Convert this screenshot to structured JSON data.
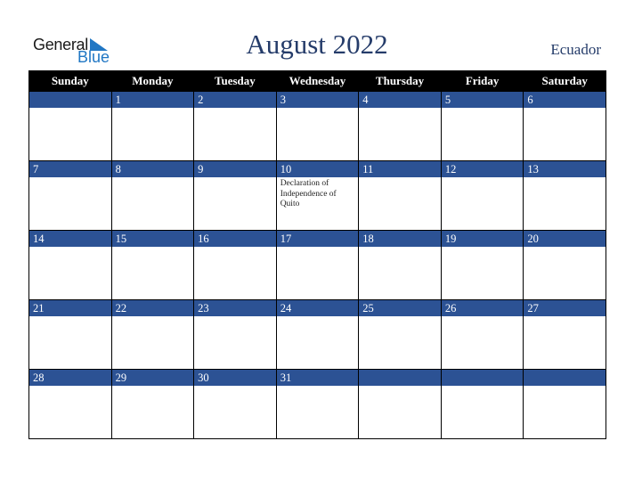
{
  "logo": {
    "word1": "General",
    "word2": "Blue"
  },
  "header": {
    "title": "August 2022",
    "country": "Ecuador"
  },
  "colors": {
    "accent": "#2c5294",
    "title": "#253c6a",
    "logo_blue": "#2177c4"
  },
  "weekdays": [
    "Sunday",
    "Monday",
    "Tuesday",
    "Wednesday",
    "Thursday",
    "Friday",
    "Saturday"
  ],
  "weeks": [
    [
      {
        "d": "",
        "e": ""
      },
      {
        "d": "1",
        "e": ""
      },
      {
        "d": "2",
        "e": ""
      },
      {
        "d": "3",
        "e": ""
      },
      {
        "d": "4",
        "e": ""
      },
      {
        "d": "5",
        "e": ""
      },
      {
        "d": "6",
        "e": ""
      }
    ],
    [
      {
        "d": "7",
        "e": ""
      },
      {
        "d": "8",
        "e": ""
      },
      {
        "d": "9",
        "e": ""
      },
      {
        "d": "10",
        "e": "Declaration of Independence of Quito"
      },
      {
        "d": "11",
        "e": ""
      },
      {
        "d": "12",
        "e": ""
      },
      {
        "d": "13",
        "e": ""
      }
    ],
    [
      {
        "d": "14",
        "e": ""
      },
      {
        "d": "15",
        "e": ""
      },
      {
        "d": "16",
        "e": ""
      },
      {
        "d": "17",
        "e": ""
      },
      {
        "d": "18",
        "e": ""
      },
      {
        "d": "19",
        "e": ""
      },
      {
        "d": "20",
        "e": ""
      }
    ],
    [
      {
        "d": "21",
        "e": ""
      },
      {
        "d": "22",
        "e": ""
      },
      {
        "d": "23",
        "e": ""
      },
      {
        "d": "24",
        "e": ""
      },
      {
        "d": "25",
        "e": ""
      },
      {
        "d": "26",
        "e": ""
      },
      {
        "d": "27",
        "e": ""
      }
    ],
    [
      {
        "d": "28",
        "e": ""
      },
      {
        "d": "29",
        "e": ""
      },
      {
        "d": "30",
        "e": ""
      },
      {
        "d": "31",
        "e": ""
      },
      {
        "d": "",
        "e": ""
      },
      {
        "d": "",
        "e": ""
      },
      {
        "d": "",
        "e": ""
      }
    ]
  ]
}
